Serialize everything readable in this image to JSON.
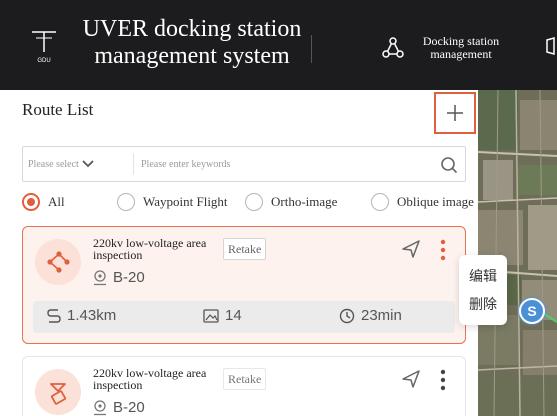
{
  "app": {
    "title": "UVER docking station management system",
    "logo_text": "GDU"
  },
  "nav": {
    "items": [
      {
        "label": "Docking station management",
        "icon": "share-nodes-icon"
      }
    ]
  },
  "route_list": {
    "title": "Route List",
    "add_icon": "plus-icon",
    "filter": {
      "select_placeholder": "Please select",
      "search_placeholder": "Please enter keywords",
      "search_value": ""
    },
    "route_types": [
      {
        "label": "All",
        "checked": true
      },
      {
        "label": "Waypoint Flight",
        "checked": false
      },
      {
        "label": "Ortho-image",
        "checked": false
      },
      {
        "label": "Oblique image",
        "checked": false
      }
    ],
    "routes": [
      {
        "name": "220kv low-voltage area inspection",
        "status": "Retake",
        "drone": "B-20",
        "distance": "1.43km",
        "photos": "14",
        "duration": "23min",
        "icon": "waypoint-route-icon",
        "selected": true
      },
      {
        "name": "220kv low-voltage area inspection",
        "status": "Retake",
        "drone": "B-20",
        "icon": "oblique-route-icon",
        "selected": false
      }
    ],
    "context_menu": {
      "edit": "编辑",
      "delete": "删除"
    }
  },
  "map": {
    "marker_label": "S"
  },
  "colors": {
    "accent": "#e0603d",
    "header_bg": "#1c1c1e",
    "selected_card_bg": "#fdf2ee",
    "marker": "#4a90d9"
  }
}
